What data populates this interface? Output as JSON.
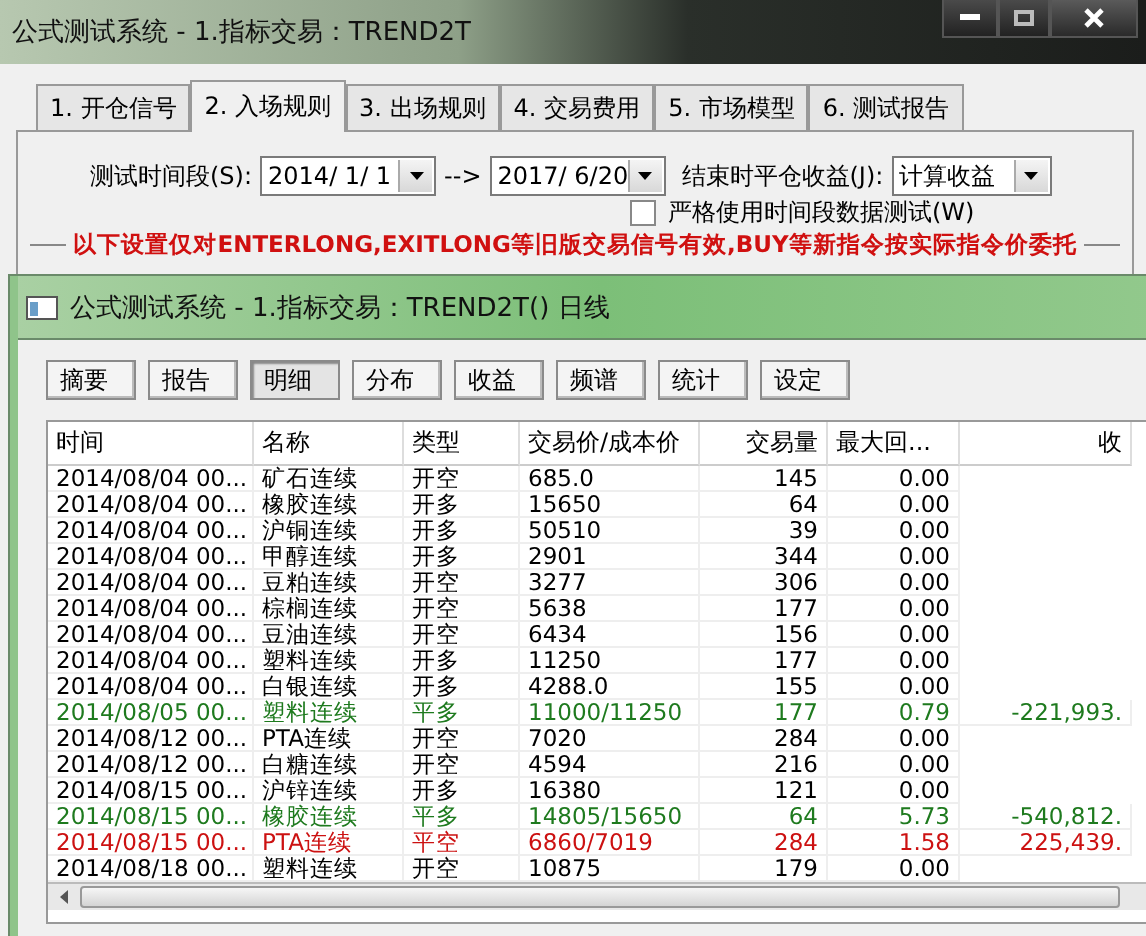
{
  "window": {
    "title": "公式测试系统 - 1.指标交易：TREND2T"
  },
  "tabs": [
    {
      "label": "1. 开仓信号",
      "selected": false
    },
    {
      "label": "2. 入场规则",
      "selected": true
    },
    {
      "label": "3. 出场规则",
      "selected": false
    },
    {
      "label": "4. 交易费用",
      "selected": false
    },
    {
      "label": "5. 市场模型",
      "selected": false
    },
    {
      "label": "6. 测试报告",
      "selected": false
    }
  ],
  "period": {
    "label": "测试时间段(S):",
    "start": "2014/ 1/ 1",
    "arrow": "-->",
    "end": "2017/ 6/20"
  },
  "close_profit": {
    "label": "结束时平仓收益(J):",
    "value": "计算收益"
  },
  "strict_check": {
    "label": "严格使用时间段数据测试(W)",
    "checked": false
  },
  "notice": "以下设置仅对ENTERLONG,EXITLONG等旧版交易信号有效,BUY等新指令按实际指令价委托",
  "report_window": {
    "title": "公式测试系统 - 1.指标交易：TREND2T() 日线",
    "buttons": [
      {
        "label": "摘要",
        "selected": false
      },
      {
        "label": "报告",
        "selected": false
      },
      {
        "label": "明细",
        "selected": true
      },
      {
        "label": "分布",
        "selected": false
      },
      {
        "label": "收益",
        "selected": false
      },
      {
        "label": "频谱",
        "selected": false
      },
      {
        "label": "统计",
        "selected": false
      },
      {
        "label": "设定",
        "selected": false
      }
    ],
    "table": {
      "columns": [
        "时间",
        "名称",
        "类型",
        "交易价/成本价",
        "交易量",
        "最大回...",
        "收"
      ],
      "rows": [
        {
          "color": "#000000",
          "cells": [
            "2014/08/04 00...",
            "矿石连续",
            "开空",
            "685.0",
            "145",
            "0.00",
            ""
          ]
        },
        {
          "color": "#000000",
          "cells": [
            "2014/08/04 00...",
            "橡胶连续",
            "开多",
            "15650",
            "64",
            "0.00",
            ""
          ]
        },
        {
          "color": "#000000",
          "cells": [
            "2014/08/04 00...",
            "沪铜连续",
            "开多",
            "50510",
            "39",
            "0.00",
            ""
          ]
        },
        {
          "color": "#000000",
          "cells": [
            "2014/08/04 00...",
            "甲醇连续",
            "开多",
            "2901",
            "344",
            "0.00",
            ""
          ]
        },
        {
          "color": "#000000",
          "cells": [
            "2014/08/04 00...",
            "豆粕连续",
            "开空",
            "3277",
            "306",
            "0.00",
            ""
          ]
        },
        {
          "color": "#000000",
          "cells": [
            "2014/08/04 00...",
            "棕榈连续",
            "开空",
            "5638",
            "177",
            "0.00",
            ""
          ]
        },
        {
          "color": "#000000",
          "cells": [
            "2014/08/04 00...",
            "豆油连续",
            "开空",
            "6434",
            "156",
            "0.00",
            ""
          ]
        },
        {
          "color": "#000000",
          "cells": [
            "2014/08/04 00...",
            "塑料连续",
            "开多",
            "11250",
            "177",
            "0.00",
            ""
          ]
        },
        {
          "color": "#000000",
          "cells": [
            "2014/08/04 00...",
            "白银连续",
            "开多",
            "4288.0",
            "155",
            "0.00",
            ""
          ]
        },
        {
          "color": "#1e7a1e",
          "cells": [
            "2014/08/05 00...",
            "塑料连续",
            "平多",
            "11000/11250",
            "177",
            "0.79",
            "-221,993."
          ]
        },
        {
          "color": "#000000",
          "cells": [
            "2014/08/12 00...",
            "PTA连续",
            "开空",
            "7020",
            "284",
            "0.00",
            ""
          ]
        },
        {
          "color": "#000000",
          "cells": [
            "2014/08/12 00...",
            "白糖连续",
            "开空",
            "4594",
            "216",
            "0.00",
            ""
          ]
        },
        {
          "color": "#000000",
          "cells": [
            "2014/08/15 00...",
            "沪锌连续",
            "开多",
            "16380",
            "121",
            "0.00",
            ""
          ]
        },
        {
          "color": "#1e7a1e",
          "cells": [
            "2014/08/15 00...",
            "橡胶连续",
            "平多",
            "14805/15650",
            "64",
            "5.73",
            "-540,812."
          ]
        },
        {
          "color": "#cc1111",
          "cells": [
            "2014/08/15 00...",
            "PTA连续",
            "平空",
            "6860/7019",
            "284",
            "1.58",
            "225,439."
          ]
        },
        {
          "color": "#000000",
          "cells": [
            "2014/08/18 00...",
            "塑料连续",
            "开空",
            "10875",
            "179",
            "0.00",
            ""
          ]
        }
      ]
    }
  }
}
